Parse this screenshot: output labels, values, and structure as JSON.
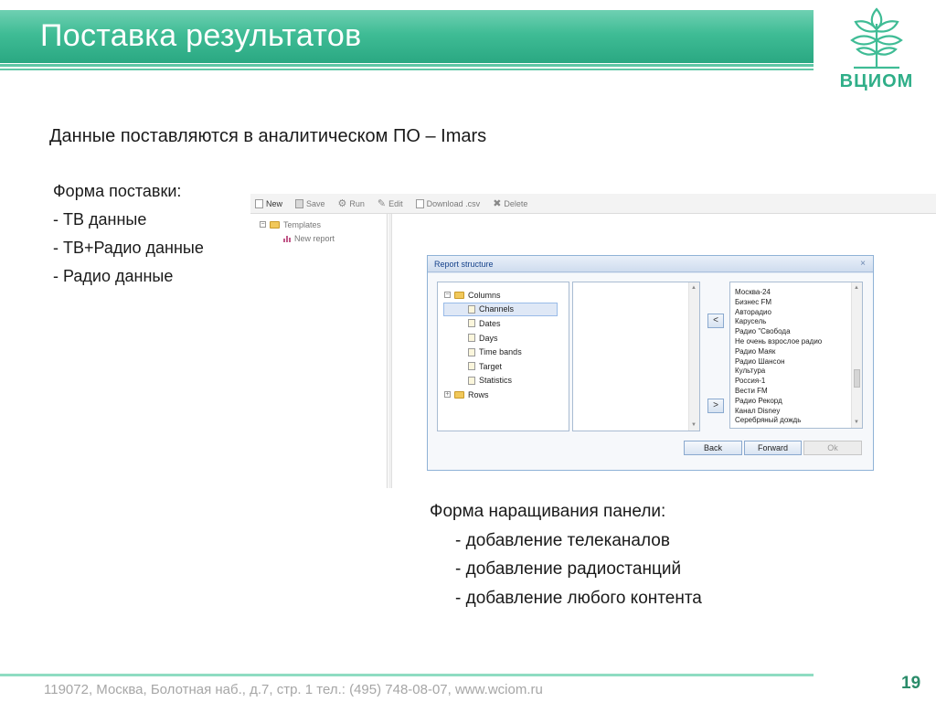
{
  "slide": {
    "title": "Поставка результатов",
    "logo_text": "ВЦИОМ",
    "lead": "Данные поставляются в аналитическом ПО – Imars",
    "left_list": [
      "Форма поставки:",
      "- ТВ данные",
      "- ТВ+Радио  данные",
      "- Радио данные"
    ],
    "right_heading": "Форма наращивания панели:",
    "right_list": [
      "- добавление телеканалов",
      "- добавление радиостанций",
      "- добавление любого контента"
    ],
    "footer": "119072, Москва, Болотная наб., д.7, стр. 1  тел.: (495) 748-08-07, www.wciom.ru",
    "page_number": "19",
    "accent_color": "#3fbc95"
  },
  "app": {
    "toolbar": {
      "new": "New",
      "save": "Save",
      "run": "Run",
      "edit": "Edit",
      "download": "Download .csv",
      "delete": "Delete"
    },
    "tree": {
      "templates": "Templates",
      "new_report": "New report"
    },
    "dialog": {
      "title": "Report structure",
      "close": "×",
      "columns": "Columns",
      "items": [
        "Channels",
        "Dates",
        "Days",
        "Time bands",
        "Target",
        "Statistics"
      ],
      "rows": "Rows",
      "move_left": "<",
      "move_right": ">",
      "stations": [
        "Москва-24",
        "Бизнес FM",
        "Авторадио",
        "Карусель",
        "Радио \"Свобода",
        "Не очень взрослое радио",
        "Радио Маяк",
        "Радио Шансон",
        "Культура",
        "Россия-1",
        "Вести FM",
        "Радио Рекорд",
        "Канал Disney",
        "Серебряный дождь"
      ],
      "back": "Back",
      "forward": "Forward",
      "ok": "Ok"
    }
  }
}
